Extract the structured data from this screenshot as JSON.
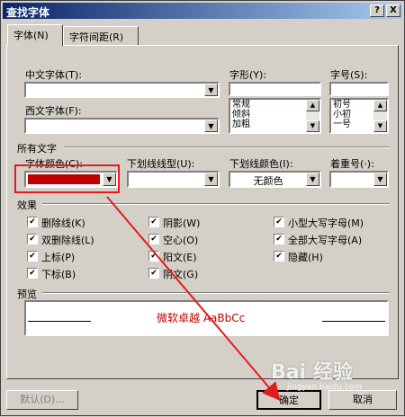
{
  "window": {
    "title": "查找字体",
    "help_label": "?",
    "close_label": "X"
  },
  "tabs": [
    {
      "label": "字体(N)"
    },
    {
      "label": "字符间距(R)"
    }
  ],
  "font": {
    "cn_font_label": "中文字体(T):",
    "cn_font_value": "",
    "west_font_label": "西文字体(F):",
    "west_font_value": "",
    "style_label": "字形(Y):",
    "style_value": "",
    "style_options": [
      "常规",
      "倾斜",
      "加粗"
    ],
    "size_label": "字号(S):",
    "size_value": "",
    "size_options": [
      "初号",
      "小初",
      "一号"
    ]
  },
  "all_text": {
    "section_label": "所有文字",
    "color_label": "字体颜色(C):",
    "color_value": "#c00000",
    "underline_type_label": "下划线线型(U):",
    "underline_type_value": "",
    "underline_color_label": "下划线颜色(I):",
    "underline_color_value": "无颜色",
    "emphasis_label": "着重号(·):",
    "emphasis_value": ""
  },
  "effects": {
    "section_label": "效果",
    "items": [
      {
        "label": "删除线(K)",
        "checked": true
      },
      {
        "label": "双删除线(L)",
        "checked": true
      },
      {
        "label": "上标(P)",
        "checked": true
      },
      {
        "label": "下标(B)",
        "checked": true
      },
      {
        "label": "阴影(W)",
        "checked": true
      },
      {
        "label": "空心(O)",
        "checked": true
      },
      {
        "label": "阳文(E)",
        "checked": true
      },
      {
        "label": "阴文(G)",
        "checked": true
      },
      {
        "label": "小型大写字母(M)",
        "checked": true
      },
      {
        "label": "全部大写字母(A)",
        "checked": true
      },
      {
        "label": "隐藏(H)",
        "checked": true
      }
    ]
  },
  "preview": {
    "section_label": "预览",
    "sample_text": "微软卓越  AaBbCc",
    "sample_color": "#c00000"
  },
  "buttons": {
    "default_label": "默认(D)...",
    "ok_label": "确定",
    "cancel_label": "取消"
  },
  "watermark": {
    "text": "Bai 经验",
    "sub": "jingyan.baidu.com"
  }
}
